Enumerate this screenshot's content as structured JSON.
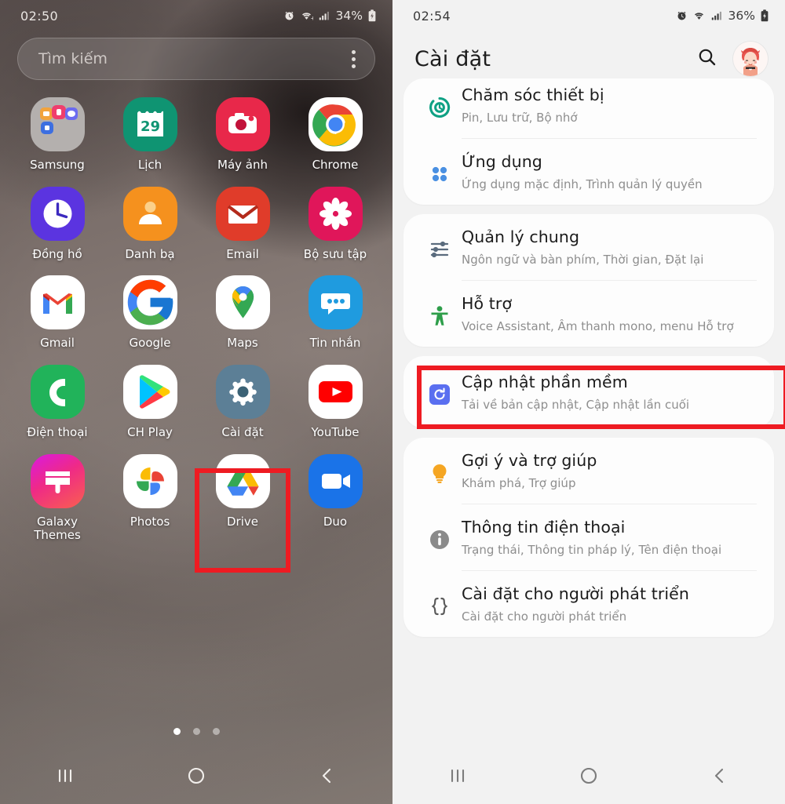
{
  "home": {
    "status": {
      "time": "02:50",
      "battery": "34%",
      "alarm_icon": "alarm-icon",
      "wifi_icon": "wifi-icon",
      "signal_icon": "signal-icon",
      "battery_icon": "battery-charging-icon"
    },
    "search": {
      "placeholder": "Tìm kiếm",
      "menu_icon": "kebab-menu-icon"
    },
    "apps": [
      {
        "label": "Samsung",
        "icon": "samsung-folder-icon"
      },
      {
        "label": "Lịch",
        "icon": "calendar-icon",
        "badge": "29"
      },
      {
        "label": "Máy ảnh",
        "icon": "camera-icon"
      },
      {
        "label": "Chrome",
        "icon": "chrome-icon"
      },
      {
        "label": "Đồng hồ",
        "icon": "clock-icon"
      },
      {
        "label": "Danh bạ",
        "icon": "contacts-icon"
      },
      {
        "label": "Email",
        "icon": "email-icon"
      },
      {
        "label": "Bộ sưu tập",
        "icon": "gallery-icon"
      },
      {
        "label": "Gmail",
        "icon": "gmail-icon"
      },
      {
        "label": "Google",
        "icon": "google-icon"
      },
      {
        "label": "Maps",
        "icon": "maps-icon"
      },
      {
        "label": "Tin nhắn",
        "icon": "messages-icon"
      },
      {
        "label": "Điện thoại",
        "icon": "phone-icon"
      },
      {
        "label": "CH Play",
        "icon": "play-store-icon"
      },
      {
        "label": "Cài đặt",
        "icon": "settings-gear-icon"
      },
      {
        "label": "YouTube",
        "icon": "youtube-icon"
      },
      {
        "label": "Galaxy Themes",
        "icon": "galaxy-themes-icon"
      },
      {
        "label": "Photos",
        "icon": "google-photos-icon"
      },
      {
        "label": "Drive",
        "icon": "google-drive-icon"
      },
      {
        "label": "Duo",
        "icon": "google-duo-icon"
      }
    ],
    "pages": {
      "count": 3,
      "active": 0
    },
    "nav": {
      "recents_icon": "recents-icon",
      "home_icon": "home-icon",
      "back_icon": "back-icon"
    }
  },
  "settings": {
    "status": {
      "time": "02:54",
      "battery": "36%",
      "alarm_icon": "alarm-icon",
      "wifi_icon": "wifi-icon",
      "signal_icon": "signal-icon",
      "battery_icon": "battery-charging-icon"
    },
    "title": "Cài đặt",
    "search_icon": "search-icon",
    "avatar_icon": "user-avatar",
    "groups": [
      {
        "items": [
          {
            "title": "Chăm sóc thiết bị",
            "subtitle": "Pin, Lưu trữ, Bộ nhớ",
            "icon": "device-care-icon",
            "color": "#0ea184"
          },
          {
            "title": "Ứng dụng",
            "subtitle": "Ứng dụng mặc định, Trình quản lý quyền",
            "icon": "apps-grid-icon",
            "color": "#4a90e2"
          }
        ]
      },
      {
        "items": [
          {
            "title": "Quản lý chung",
            "subtitle": "Ngôn ngữ và bàn phím, Thời gian, Đặt lại",
            "icon": "general-management-icon",
            "color": "#5a6b7d"
          },
          {
            "title": "Hỗ trợ",
            "subtitle": "Voice Assistant, Âm thanh mono, menu Hỗ trợ",
            "icon": "accessibility-icon",
            "color": "#2e9e4a"
          }
        ]
      },
      {
        "highlighted": true,
        "items": [
          {
            "title": "Cập nhật phần mềm",
            "subtitle": "Tải về bản cập nhật, Cập nhật lần cuối",
            "icon": "software-update-icon",
            "color": "#5a6ff0"
          }
        ]
      },
      {
        "items": [
          {
            "title": "Gợi ý và trợ giúp",
            "subtitle": "Khám phá, Trợ giúp",
            "icon": "lightbulb-icon",
            "color": "#f5a623"
          },
          {
            "title": "Thông tin điện thoại",
            "subtitle": "Trạng thái, Thông tin pháp lý, Tên điện thoại",
            "icon": "info-icon",
            "color": "#8a8a8a"
          },
          {
            "title": "Cài đặt cho người phát triển",
            "subtitle": "Cài đặt cho người phát triển",
            "icon": "developer-options-icon",
            "color": "#5a5a5a"
          }
        ]
      }
    ],
    "nav": {
      "recents_icon": "recents-icon",
      "home_icon": "home-icon",
      "back_icon": "back-icon"
    }
  },
  "annotation": {
    "highlight_color": "#ee1b22"
  }
}
